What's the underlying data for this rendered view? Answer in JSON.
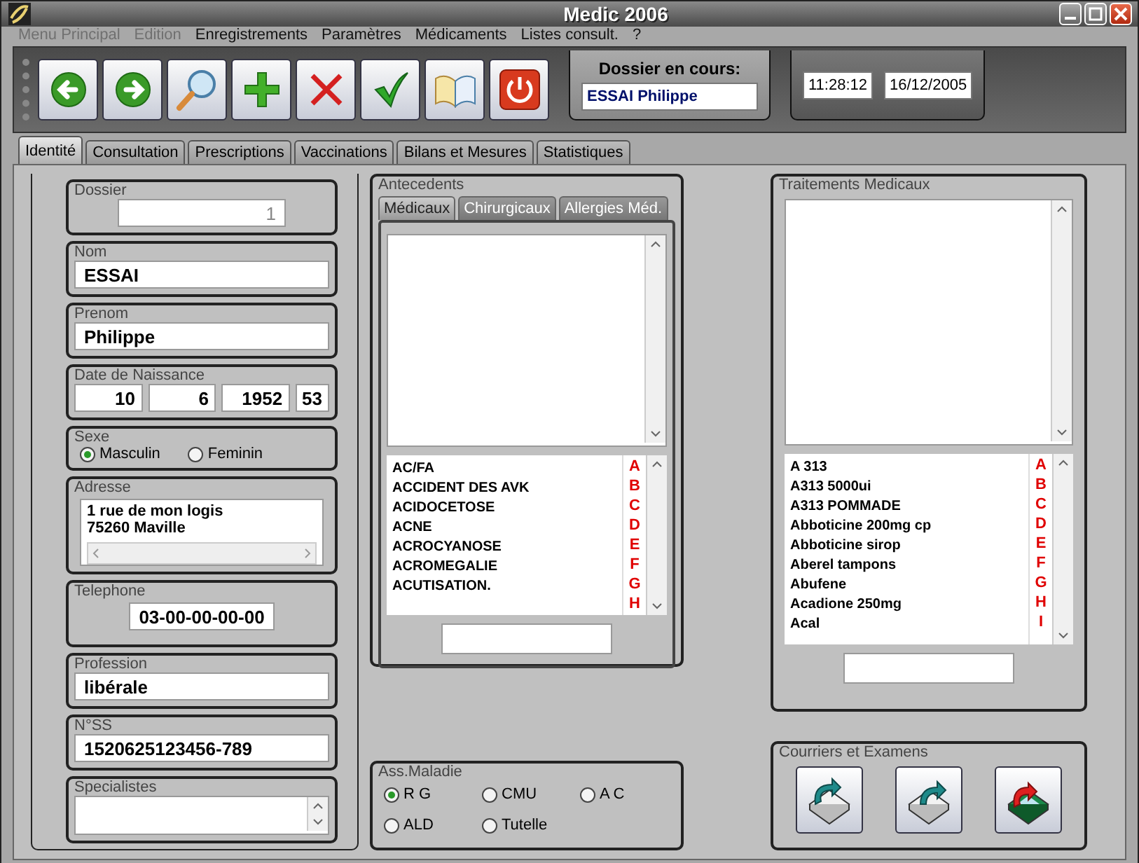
{
  "window": {
    "title": "Medic 2006"
  },
  "menu": [
    {
      "label": "Menu Principal",
      "disabled": true
    },
    {
      "label": "Edition",
      "disabled": true
    },
    {
      "label": "Enregistrements",
      "disabled": false
    },
    {
      "label": "Paramètres",
      "disabled": false
    },
    {
      "label": "Médicaments",
      "disabled": false
    },
    {
      "label": "Listes consult.",
      "disabled": false
    },
    {
      "label": "?",
      "disabled": false
    }
  ],
  "toolbar": {
    "buttons": [
      {
        "kind": "back"
      },
      {
        "kind": "forward"
      },
      {
        "kind": "search"
      },
      {
        "kind": "add"
      },
      {
        "kind": "delete"
      },
      {
        "kind": "validate"
      },
      {
        "kind": "book"
      },
      {
        "kind": "power"
      }
    ]
  },
  "current_file": {
    "label": "Dossier en cours:",
    "value": "ESSAI Philippe"
  },
  "clock": {
    "time": "11:28:12",
    "date": "16/12/2005"
  },
  "tabs": [
    {
      "label": "Identité",
      "selected": true
    },
    {
      "label": "Consultation",
      "selected": false
    },
    {
      "label": "Prescriptions",
      "selected": false
    },
    {
      "label": "Vaccinations",
      "selected": false
    },
    {
      "label": "Bilans et Mesures",
      "selected": false
    },
    {
      "label": "Statistiques",
      "selected": false
    }
  ],
  "identity": {
    "dossier": {
      "label": "Dossier",
      "value": "1",
      "disabled": true
    },
    "nom": {
      "label": "Nom",
      "value": "ESSAI"
    },
    "prenom": {
      "label": "Prenom",
      "value": "Philippe"
    },
    "birth": {
      "label": "Date de Naissance",
      "values": [
        "10",
        "6",
        "1952",
        "53"
      ]
    },
    "sexe": {
      "label": "Sexe",
      "options": [
        {
          "label": "Masculin",
          "selected": true
        },
        {
          "label": "Feminin",
          "selected": false
        }
      ]
    },
    "adresse": {
      "label": "Adresse",
      "lines": [
        "1 rue de mon logis",
        "75260 Maville"
      ]
    },
    "telephone": {
      "label": "Telephone",
      "value": "03-00-00-00-00"
    },
    "profession": {
      "label": "Profession",
      "value": "libérale"
    },
    "nss": {
      "label": "N°SS",
      "value": "1520625123456-789"
    },
    "specialistes": {
      "label": "Specialistes"
    }
  },
  "antecedents": {
    "title": "Antecedents",
    "tabs": [
      {
        "label": "Médicaux",
        "selected": true
      },
      {
        "label": "Chirurgicaux",
        "selected": false
      },
      {
        "label": "Allergies Méd.",
        "selected": false
      }
    ],
    "items": [
      "AC/FA",
      "ACCIDENT DES AVK",
      "ACIDOCETOSE",
      "ACNE",
      "ACROCYANOSE",
      "ACROMEGALIE",
      "ACUTISATION."
    ],
    "letters": [
      "A",
      "B",
      "C",
      "D",
      "E",
      "F",
      "G",
      "H"
    ]
  },
  "insurance": {
    "title": "Ass.Maladie",
    "options": [
      {
        "label": "R G",
        "selected": true
      },
      {
        "label": "CMU",
        "selected": false
      },
      {
        "label": "A C",
        "selected": false
      },
      {
        "label": "ALD",
        "selected": false
      },
      {
        "label": "Tutelle",
        "selected": false
      }
    ]
  },
  "treatments": {
    "title": "Traitements Medicaux",
    "items": [
      "A 313",
      "A313 5000ui",
      "A313 POMMADE",
      "Abboticine 200mg cp",
      "Abboticine sirop",
      "Aberel tampons",
      "Abufene",
      "Acadione 250mg",
      "Acal"
    ],
    "letters": [
      "A",
      "B",
      "C",
      "D",
      "E",
      "F",
      "G",
      "H",
      "I"
    ]
  },
  "letters_exams": {
    "title": "Courriers et Examens",
    "buttons": [
      {
        "kind": "tray-in"
      },
      {
        "kind": "tray-out"
      },
      {
        "kind": "tray-return"
      }
    ]
  }
}
